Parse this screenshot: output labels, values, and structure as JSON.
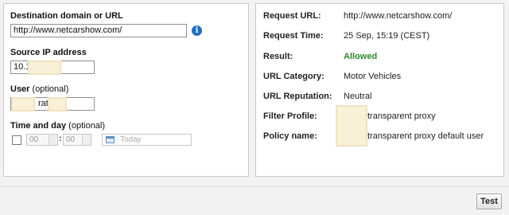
{
  "form": {
    "destination_label": "Destination domain or URL",
    "destination_value": "http://www.netcarshow.com/",
    "source_ip_label": "Source IP address",
    "source_ip_value": "10.1",
    "user_label": "User",
    "user_optional": "(optional)",
    "user_value": "rat",
    "time_label": "Time and day",
    "time_optional": "(optional)",
    "hour": "00",
    "minute": "00",
    "time_separator": ":",
    "date_placeholder": "Today",
    "info_icon": "info-icon"
  },
  "result": {
    "request_url_label": "Request URL:",
    "request_url_value": "http://www.netcarshow.com/",
    "request_time_label": "Request Time:",
    "request_time_value": "25 Sep, 15:19 (CEST)",
    "result_label": "Result:",
    "result_value": "Allowed",
    "category_label": "URL Category:",
    "category_value": "Motor Vehicles",
    "reputation_label": "URL Reputation:",
    "reputation_value": "Neutral",
    "filter_profile_label": "Filter Profile:",
    "filter_profile_value": "transparent proxy",
    "policy_name_label": "Policy name:",
    "policy_name_value": "transparent proxy default user",
    "allowed_color": "#2c8a2c"
  },
  "footer": {
    "test_label": "Test"
  }
}
